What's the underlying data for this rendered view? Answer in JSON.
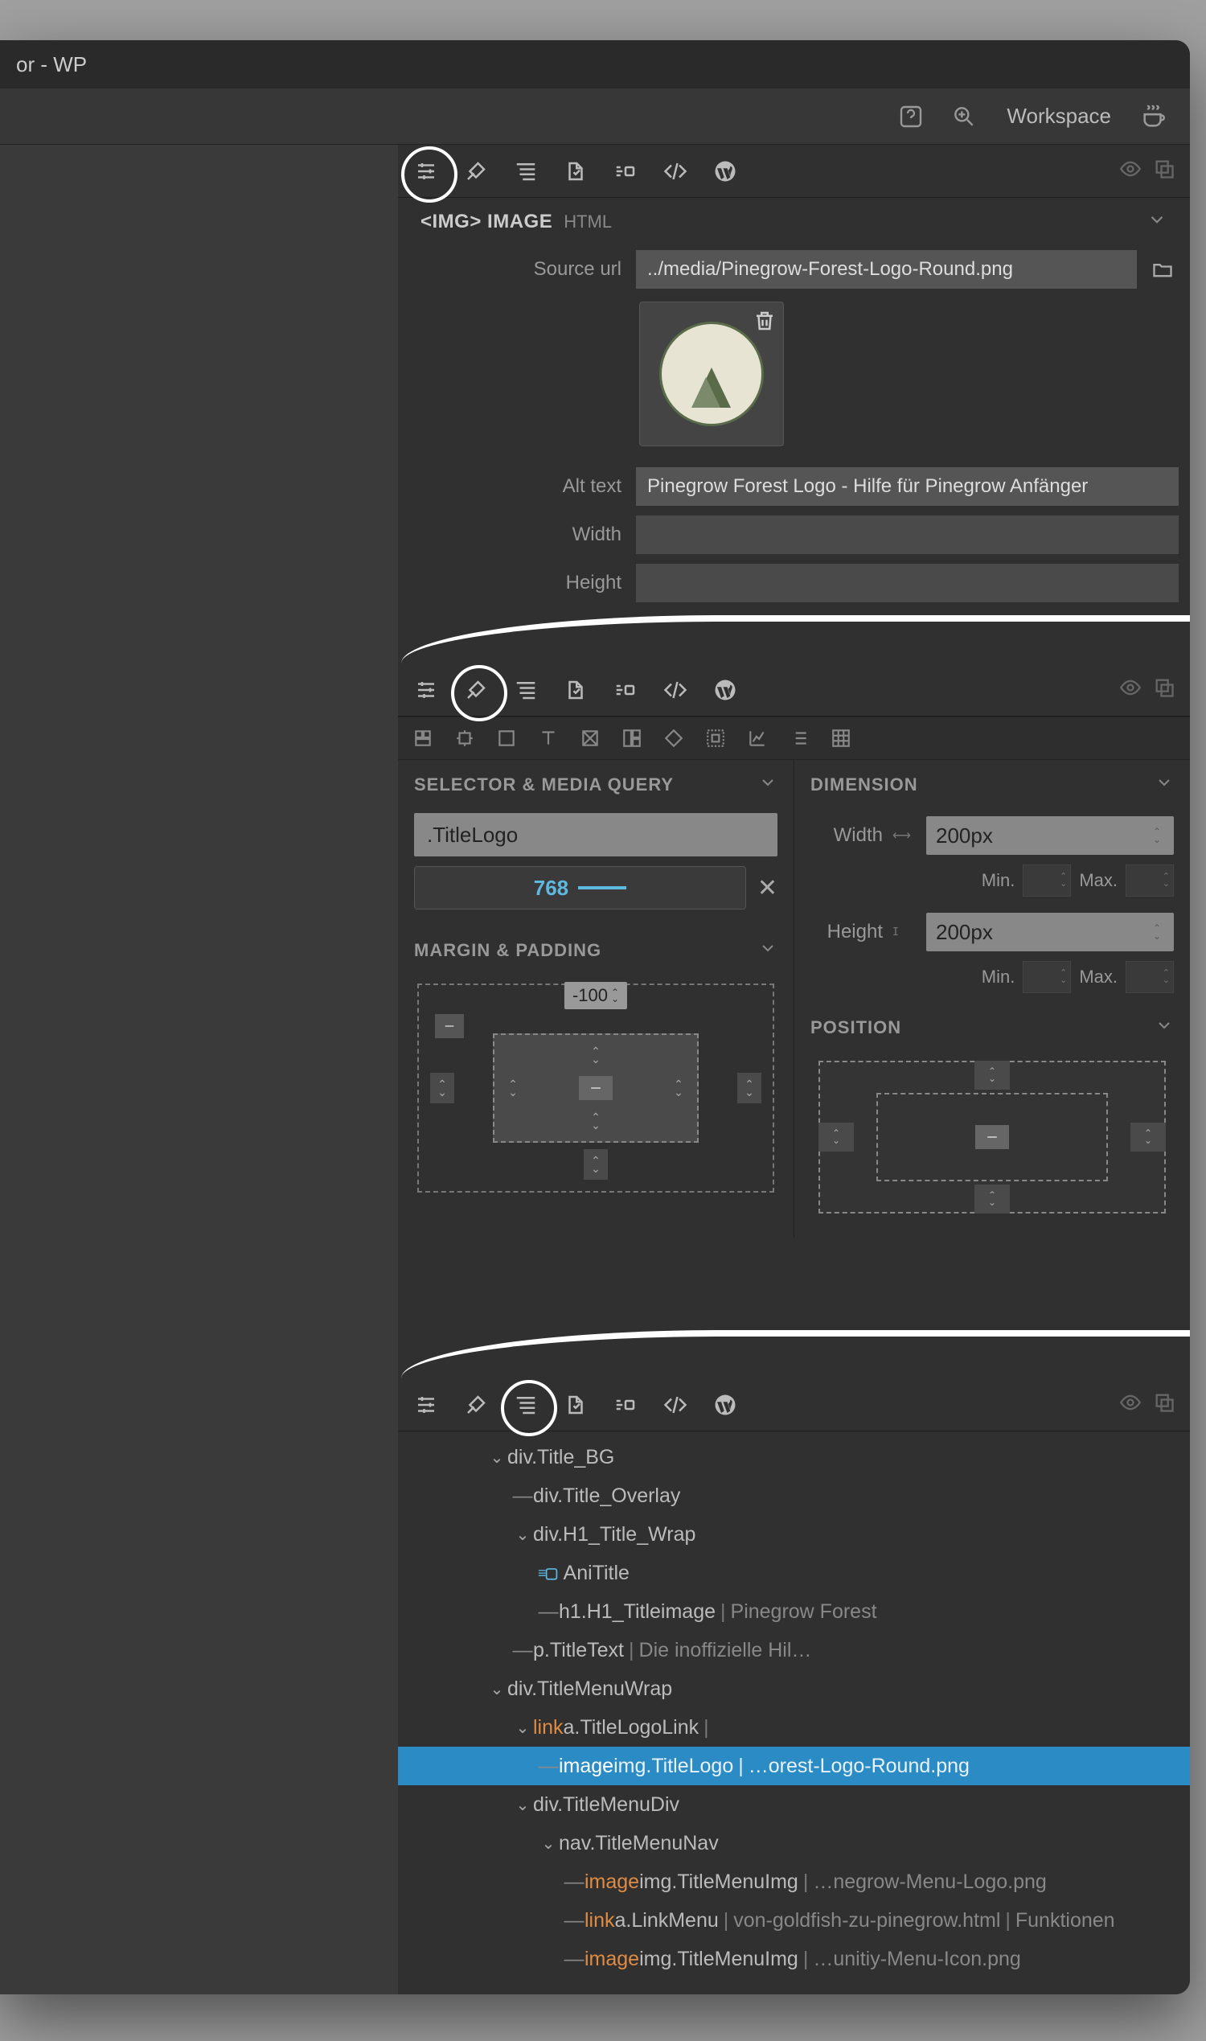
{
  "window": {
    "title": "or - WP"
  },
  "topbar": {
    "workspace": "Workspace"
  },
  "panel1": {
    "heading_tag": "<IMG> IMAGE",
    "heading_sub": "HTML",
    "fields": {
      "source_url": {
        "label": "Source url",
        "value": "../media/Pinegrow-Forest-Logo-Round.png"
      },
      "alt_text": {
        "label": "Alt text",
        "value": "Pinegrow Forest Logo - Hilfe für Pinegrow Anfänger"
      },
      "width": {
        "label": "Width",
        "value": ""
      },
      "height": {
        "label": "Height",
        "value": ""
      }
    }
  },
  "panel2": {
    "selector": {
      "heading": "SELECTOR & MEDIA QUERY",
      "value": ".TitleLogo",
      "media_query": "768"
    },
    "margin_padding": {
      "heading": "MARGIN & PADDING",
      "margin_top": "-100"
    },
    "dimension": {
      "heading": "DIMENSION",
      "width_label": "Width",
      "width_value": "200px",
      "height_label": "Height",
      "height_value": "200px",
      "min_label": "Min.",
      "max_label": "Max."
    },
    "position": {
      "heading": "POSITION"
    }
  },
  "panel3": {
    "tree": [
      {
        "depth": 0,
        "toggle": "expand",
        "label": "div.Title_BG"
      },
      {
        "depth": 1,
        "toggle": "dash",
        "label": "div.Title_Overlay"
      },
      {
        "depth": 1,
        "toggle": "expand",
        "label": "div.H1_Title_Wrap"
      },
      {
        "depth": 2,
        "toggle": "ani",
        "label": "AniTitle"
      },
      {
        "depth": 2,
        "toggle": "dash",
        "label": "h1.H1_Titleimage",
        "text": "Pinegrow Forest"
      },
      {
        "depth": 1,
        "toggle": "dash",
        "label": "p.TitleText",
        "text": "Die inoffizielle Hil…"
      },
      {
        "depth": 0,
        "toggle": "expand",
        "label": "div.TitleMenuWrap"
      },
      {
        "depth": 1,
        "toggle": "expand",
        "prefix": "link",
        "label": "a.TitleLogoLink",
        "text": ""
      },
      {
        "depth": 2,
        "toggle": "dash",
        "prefix": "image",
        "label": "img.TitleLogo",
        "text": "…orest-Logo-Round.png",
        "selected": true
      },
      {
        "depth": 1,
        "toggle": "expand",
        "label": "div.TitleMenuDiv"
      },
      {
        "depth": 2,
        "toggle": "expand",
        "label": "nav.TitleMenuNav"
      },
      {
        "depth": 3,
        "toggle": "dash",
        "prefix": "image",
        "label": "img.TitleMenuImg",
        "text": "…negrow-Menu-Logo.png"
      },
      {
        "depth": 3,
        "toggle": "dash",
        "prefix": "link",
        "label": "a.LinkMenu",
        "text": "von-goldfish-zu-pinegrow.html",
        "text2": "Funktionen"
      },
      {
        "depth": 3,
        "toggle": "dash",
        "prefix": "image",
        "label": "img.TitleMenuImg",
        "text": "…unitiy-Menu-Icon.png"
      }
    ]
  }
}
